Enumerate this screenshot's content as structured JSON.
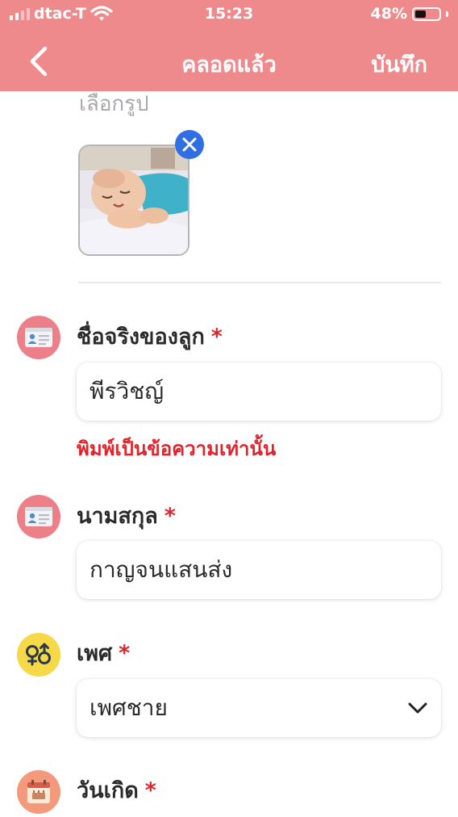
{
  "status_bar": {
    "carrier": "dtac-T",
    "time": "15:23",
    "battery": "48%",
    "battery_level": 0.48
  },
  "nav": {
    "title": "คลอดแล้ว",
    "save_label": "บันทึก",
    "back_icon": "chevron-left-icon"
  },
  "photo": {
    "caption": "เลือกรูป"
  },
  "form": {
    "first_name": {
      "label": "ชื่อจริงของลูก",
      "required_mark": "*",
      "value": "พีรวิชญ์",
      "error": "พิมพ์เป็นข้อความเท่านั้น",
      "icon": "id-card-icon"
    },
    "last_name": {
      "label": "นามสกุล",
      "required_mark": "*",
      "value": "กาญจนแสนส่ง",
      "icon": "id-card-icon"
    },
    "gender": {
      "label": "เพศ",
      "required_mark": "*",
      "value": "เพศชาย",
      "icon": "gender-icon"
    },
    "birthday": {
      "label": "วันเกิด",
      "required_mark": "*",
      "icon": "calendar-icon"
    }
  },
  "colors": {
    "header": "#ef8a8c",
    "required": "#e0242d",
    "remove_button": "#2f6fe3",
    "gender_icon_bg": "#f6d849",
    "id_icon_bg": "#ec7f87",
    "calendar_icon_bg": "#f29a7b"
  }
}
